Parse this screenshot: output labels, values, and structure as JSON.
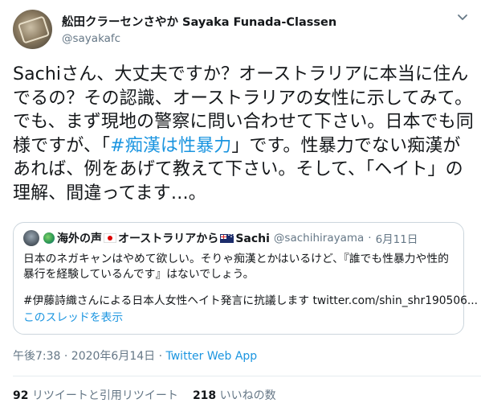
{
  "author": {
    "display_name": "舩田クラーセンさやか Sayaka Funada-Classen",
    "handle": "@sayakafc"
  },
  "tweet": {
    "text_before": "Sachiさん、大丈夫ですか？オーストラリアに本当に住んでるの？その認識、オーストラリアの女性に示してみて。でも、まず現地の警察に問い合わせて下さい。日本でも同様ですが、「",
    "hashtag": "#痴漢は性暴力",
    "text_after": "」です。性暴力でない痴漢があれば、例をあげて教えて下さい。そして、「ヘイト」の理解、間違ってます…。"
  },
  "quote": {
    "name_prefix": "海外の声",
    "name_middle": "オーストラリアから",
    "name_suffix": "Sachi",
    "handle": "@sachihirayama",
    "separator": "·",
    "date": "6月11日",
    "body": "日本のネガキャンはやめて欲しい。そりゃ痴漢とかはいるけど、『誰でも性暴力や性的暴行を経験しているんです』はないでしょう。",
    "hashtag_line": "#伊藤詩織さんによる日本人女性ヘイト発言に抗議します",
    "link": "twitter.com/shin_shr190506...",
    "thread_link": "このスレッドを表示"
  },
  "meta": {
    "time_date": "午後7:38 · 2020年6月14日 · ",
    "source": "Twitter Web App"
  },
  "stats": {
    "retweets_count": "92",
    "retweets_label": "リツイートと引用リツイート",
    "likes_count": "218",
    "likes_label": "いいねの数"
  }
}
